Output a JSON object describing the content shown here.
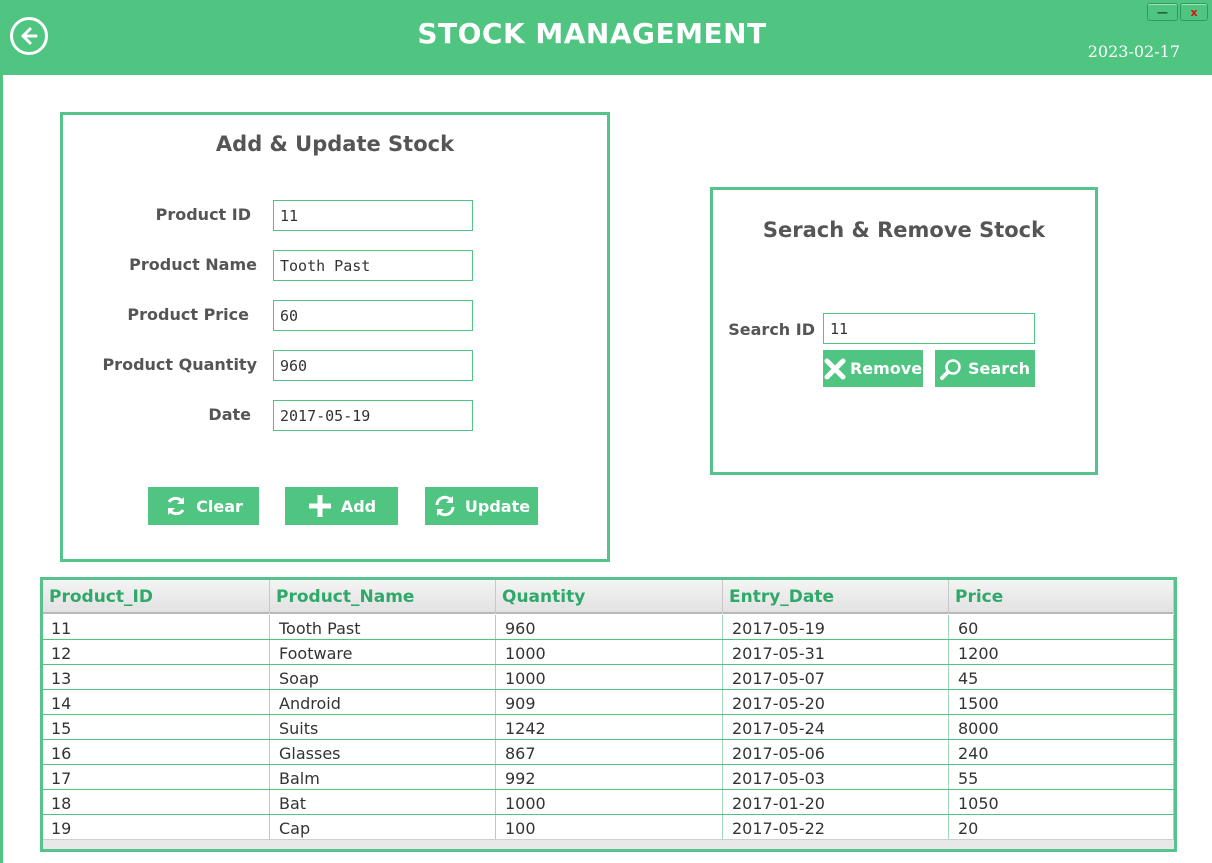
{
  "header": {
    "title": "STOCK MANAGEMENT",
    "date": "2023-02-17",
    "minimize_label": "—",
    "close_label": "x",
    "back_icon": "arrow-left-circle-icon"
  },
  "colors": {
    "accent": "#4fc581",
    "border": "#56c38a",
    "label": "#555555",
    "header_text": "#2fa96a"
  },
  "add_update": {
    "title": "Add & Update Stock",
    "fields": [
      {
        "label": "Product ID",
        "value": "11"
      },
      {
        "label": "Product Name",
        "value": "Tooth Past"
      },
      {
        "label": "Product Price",
        "value": "60"
      },
      {
        "label": "Product Quantity",
        "value": "960"
      },
      {
        "label": "Date",
        "value": "2017-05-19"
      }
    ],
    "buttons": {
      "clear": "Clear",
      "add": "Add",
      "update": "Update"
    }
  },
  "search_remove": {
    "title": "Serach & Remove Stock",
    "search_label": "Search ID",
    "search_value": "11",
    "remove": "Remove",
    "search": "Search"
  },
  "table": {
    "columns": [
      "Product_ID",
      "Product_Name",
      "Quantity",
      "Entry_Date",
      "Price"
    ],
    "rows": [
      [
        "11",
        "Tooth Past",
        "960",
        "2017-05-19",
        "60"
      ],
      [
        "12",
        "Footware",
        "1000",
        "2017-05-31",
        "1200"
      ],
      [
        "13",
        "Soap",
        "1000",
        "2017-05-07",
        "45"
      ],
      [
        "14",
        "Android",
        "909",
        "2017-05-20",
        "1500"
      ],
      [
        "15",
        "Suits",
        "1242",
        "2017-05-24",
        "8000"
      ],
      [
        "16",
        "Glasses",
        "867",
        "2017-05-06",
        "240"
      ],
      [
        "17",
        "Balm",
        "992",
        "2017-05-03",
        "55"
      ],
      [
        "18",
        "Bat",
        "1000",
        "2017-01-20",
        "1050"
      ],
      [
        "19",
        "Cap",
        "100",
        "2017-05-22",
        "20"
      ]
    ]
  }
}
